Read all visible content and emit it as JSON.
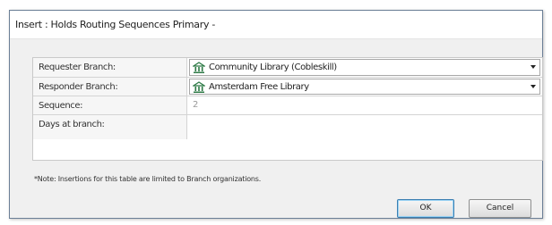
{
  "window": {
    "title": "Insert : Holds Routing Sequences Primary -"
  },
  "form": {
    "requester_branch": {
      "label": "Requester Branch:",
      "value": "Community Library (Cobleskill)",
      "icon": "library-building-icon"
    },
    "responder_branch": {
      "label": "Responder Branch:",
      "value": "Amsterdam Free Library",
      "icon": "library-building-icon"
    },
    "sequence": {
      "label": "Sequence:",
      "value": "2"
    },
    "days_at_branch": {
      "label": "Days at branch:",
      "value": ""
    }
  },
  "note": "*Note: Insertions for this table are limited to Branch organizations.",
  "buttons": {
    "ok_label": "OK",
    "cancel_label": "Cancel"
  },
  "colors": {
    "library_icon": "#2d7a46",
    "ok_border": "#3c7fb1"
  }
}
